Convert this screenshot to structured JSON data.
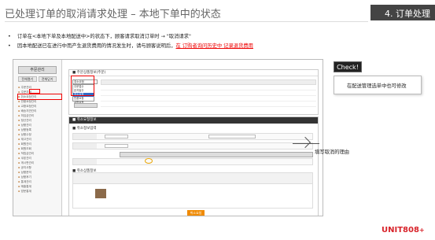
{
  "header": {
    "title": "已处理订单的取消请求处理 – 本地下单中的状态",
    "chapter": "4. 订单处理"
  },
  "bullets": {
    "b1_part1": "订单在<本地下单及本地配送中>的状态下，顾客请求取消订单时",
    "b1_arrow": "→",
    "b1_part2": "\"取消请求\"",
    "b2_part1": "因本地配送已在进行中而产生退货费用的情况发生时，请与顾客说明后，",
    "b2_part2": "在 订购者询问历史中 记录退货费用"
  },
  "shot": {
    "side_title": "주문관리",
    "side_btn1": "전체열기",
    "side_btn2": "전체닫기",
    "tree": [
      "주문관리",
      "주문조회",
      "취소요청관리",
      "반품요청관리",
      "교환요청관리",
      "배송지연관리",
      "미입금관리",
      "정산관리",
      "상품관리",
      "상품등록",
      "상품수정",
      "재고관리",
      "회원관리",
      "회원조회",
      "적립금관리",
      "쿠폰관리",
      "게시판관리",
      "공지사항",
      "상품문의",
      "상품후기",
      "통계관리",
      "매출통계",
      "방문통계"
    ],
    "panel1_title": "■ 주문상품정보(주문)",
    "select_value": "취소요청",
    "dropdown": [
      "주문접수",
      "본지발주",
      "취소요청",
      "반품요청",
      "교환요청"
    ],
    "panel2_title": "■ 취소요청정보",
    "section_title": "■ 취소정보입력",
    "section2_title": "■ 취소상품정보",
    "button_label": "취소요청"
  },
  "check": {
    "label": "Check!",
    "note": "在配送管理选单中也可修改"
  },
  "annotation": "填写取消的理由",
  "logo": {
    "text": "UNIT808",
    "plus": "+"
  }
}
